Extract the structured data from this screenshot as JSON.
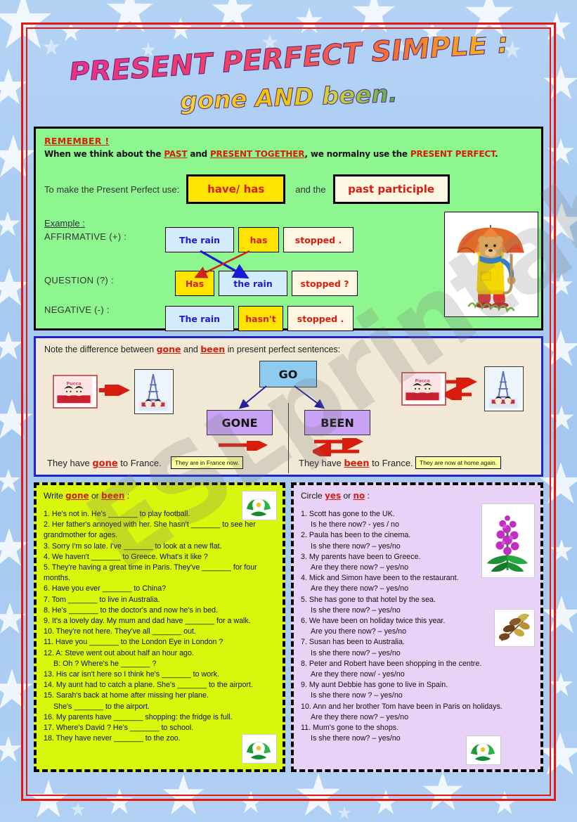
{
  "title": {
    "line1": "PRESENT PERFECT SIMPLE :",
    "line2": "gone AND been."
  },
  "watermark": "ESLprintables.com",
  "remember_box": {
    "heading": "REMEMBER !",
    "intro_a": "When we think about the ",
    "intro_past": "PAST",
    "intro_b": " and ",
    "intro_present": "PRESENT TOGETHER",
    "intro_c": ", we normalny use the ",
    "intro_pp": "PRESENT PERFECT",
    "intro_d": ".",
    "make_label": "To make the Present Perfect use:",
    "chip_have_has": "have/ has",
    "and_the": "and the",
    "chip_past_participle": "past participle",
    "example_label": "Example :",
    "rows": [
      {
        "label": "AFFIRMATIVE (+) :",
        "c1": "The rain",
        "c2": "has",
        "c3": "stopped ."
      },
      {
        "label": "QUESTION (?) :",
        "c1": "Has",
        "c2": "the rain",
        "c3": "stopped ?"
      },
      {
        "label": "NEGATIVE (-) :",
        "c1": "The rain",
        "c2": "hasn't",
        "c3": "stopped ."
      }
    ],
    "image_alt": "teddy-bear-with-umbrella"
  },
  "diagram_box": {
    "note_a": "Note the difference between ",
    "note_gone": "gone",
    "note_b": " and ",
    "note_been": "been",
    "note_c": " in present perfect sentences:",
    "go": "GO",
    "gone": "GONE",
    "been": "BEEN",
    "sentence_gone_a": "They have ",
    "sentence_gone_b": "gone",
    "sentence_gone_c": " to France.",
    "sentence_been_a": "They have ",
    "sentence_been_b": "been",
    "sentence_been_c": " to France.",
    "caption_gone": "They are in France now.",
    "caption_been": "They are now at home again.",
    "image_home_alt": "pucca-at-home",
    "image_paris_alt": "pucca-at-eiffel-tower"
  },
  "exercise_left": {
    "title_a": "Write ",
    "title_gone": "gone",
    "title_or": " or ",
    "title_been": "been",
    "title_colon": " :",
    "items": [
      "1. He's not in. He's _______ to play football.",
      "2. Her father's annoyed with her. She hasn't _______ to see her grandmother for ages.",
      "3. Sorry I'm so late. I've _______ to look at a new flat.",
      "4. We haven't _______ to Greece. What's it like ?",
      "5. They're having a great time in Paris. They've _______ for four months.",
      "6. Have you ever _______ to China?",
      "7. Tom _______ to live in Australia.",
      "8. He's _______ to the doctor's and now he's in bed.",
      "9. It's a lovely day. My mum and dad have _______ for a walk.",
      "10. They're not here. They've all _______ out.",
      "11. Have you _______ to the London Eye in London ?",
      "12. A: Steve went out about half an hour ago.",
      "13. His car isn't here so I think he's _______ to work.",
      "14. My aunt had to catch a plane. She's _______ to the airport.",
      "15. Sarah's back at home after missing her plane.",
      "16. My parents have _______ shopping: the fridge is full.",
      "17. Where's David ? He's _______ to school.",
      "18. They have never _______ to the zoo."
    ],
    "sub_12": "B: Oh ? Where's he _______ ?",
    "sub_15": "She's _______ to the airport.",
    "clip_top_alt": "white-flower-clipart",
    "clip_bottom_alt": "white-flower-clipart"
  },
  "exercise_right": {
    "title_a": "Circle ",
    "title_yes": "yes",
    "title_or": " or ",
    "title_no": "no",
    "title_colon": " :",
    "items": [
      {
        "q": "1. Scott has gone to the UK.",
        "a": "Is he there now?  - yes / no"
      },
      {
        "q": "2. Paula has been to the cinema.",
        "a": "Is she there now? – yes/no"
      },
      {
        "q": "3. My parents have been to Greece.",
        "a": "Are they there now? – yes/no"
      },
      {
        "q": "4. Mick and Simon have been to the restaurant.",
        "a": "Are they there now? – yes/no"
      },
      {
        "q": "5. She has gone to that hotel by the sea.",
        "a": "Is she there now? – yes/no"
      },
      {
        "q": "6. We have been on holiday twice this year.",
        "a": "Are you there now? – yes/no"
      },
      {
        "q": "7. Susan has been to Australia.",
        "a": "Is she there now? – yes/no"
      },
      {
        "q": "8. Peter and Robert have been shopping in the centre.",
        "a": "Are they there now/ - yes/no"
      },
      {
        "q": "9. My aunt Debbie has gone to live in Spain.",
        "a": "Is she there now ? – yes/no"
      },
      {
        "q": "10. Ann and her brother Tom have been in Paris on holidays.",
        "a": "Are they there now? – yes/no"
      },
      {
        "q": "11. Mum's gone to the shops.",
        "a": "Is she there now? – yes/no"
      }
    ],
    "clip_top_alt": "pink-fireweed-flower-clipart",
    "clip_mid_alt": "autumn-leaves-clipart",
    "clip_bottom_alt": "white-flower-clipart"
  },
  "colors": {
    "page_bg": "#a9ccf2",
    "frame": "#e8160c",
    "green_box": "#8ef68e",
    "diagram_box": "#f1e9d6",
    "diagram_border": "#2222cc",
    "exercise_left_bg": "#d7f70c",
    "exercise_right_bg": "#e9d2f7",
    "accent_red": "#d81d0f",
    "chip_yellow": "#ffe400",
    "go_blue": "#8ecbf0",
    "go_purple": "#c9a2f5"
  }
}
